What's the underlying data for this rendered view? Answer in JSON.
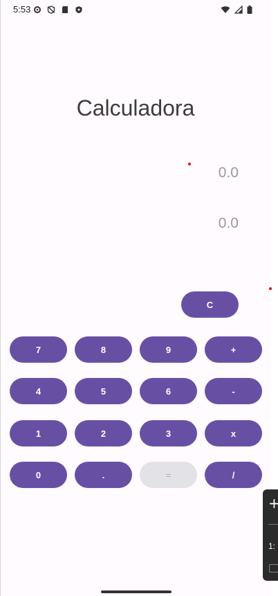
{
  "status": {
    "time": "5:53",
    "left_icons": [
      "gear-icon",
      "shield-off-icon",
      "sd-card-icon",
      "shield-icon"
    ],
    "right_icons": [
      "wifi-icon",
      "signal-icon",
      "battery-icon"
    ]
  },
  "title": "Calculadora",
  "display": {
    "top_value": "0.0",
    "bottom_value": "0.0"
  },
  "buttons": {
    "clear": "C",
    "row1": [
      "7",
      "8",
      "9",
      "+"
    ],
    "row2": [
      "4",
      "5",
      "6",
      "-"
    ],
    "row3": [
      "1",
      "2",
      "3",
      "x"
    ],
    "row4": [
      "0",
      ".",
      "=",
      "/"
    ]
  },
  "side_panel": {
    "plus": "+",
    "ratio": "1:"
  },
  "colors": {
    "accent": "#6750a4",
    "disabled": "#e3e2e6",
    "background": "#fffbfe"
  }
}
